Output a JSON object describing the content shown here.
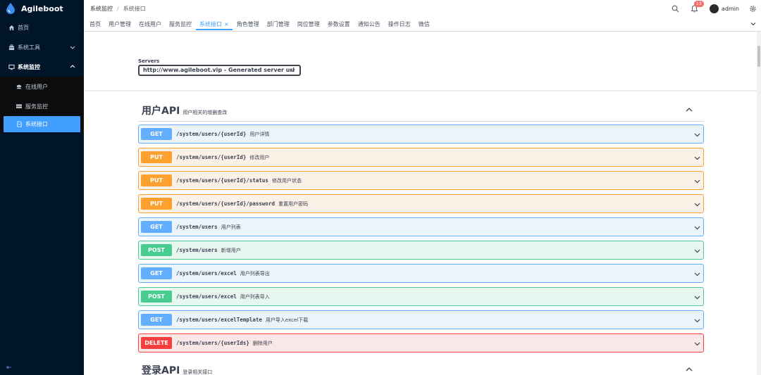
{
  "app": {
    "name": "Agileboot"
  },
  "sidebar": {
    "items": [
      {
        "label": "首页",
        "icon": "home-icon"
      },
      {
        "label": "系统工具",
        "icon": "toolbox-icon"
      },
      {
        "label": "系统监控",
        "icon": "monitor-icon"
      }
    ],
    "submenu": [
      {
        "label": "在线用户",
        "icon": "users-icon"
      },
      {
        "label": "服务监控",
        "icon": "server-icon"
      },
      {
        "label": "系统接口",
        "icon": "document-icon"
      }
    ],
    "collapse_glyph": "⇤"
  },
  "breadcrumb": {
    "parent": "系统监控",
    "separator": "/",
    "current": "系统接口"
  },
  "navbar": {
    "notification_count": "13",
    "username": "admin"
  },
  "tags": [
    "首页",
    "用户管理",
    "在线用户",
    "服务监控",
    "系统接口",
    "角色管理",
    "部门管理",
    "岗位管理",
    "参数设置",
    "通知公告",
    "操作日志",
    "微信"
  ],
  "tags_active": "系统接口",
  "servers": {
    "label": "Servers",
    "selected": "http://www.agileboot.vip - Generated server url"
  },
  "sections": [
    {
      "title": "用户API",
      "description": "用户相关的增删查改",
      "operations": [
        {
          "method": "GET",
          "path": "/system/users/{userId}",
          "summary": "用户详情"
        },
        {
          "method": "PUT",
          "path": "/system/users/{userId}",
          "summary": "修改用户"
        },
        {
          "method": "PUT",
          "path": "/system/users/{userId}/status",
          "summary": "修改用户状态"
        },
        {
          "method": "PUT",
          "path": "/system/users/{userId}/password",
          "summary": "重置用户密码"
        },
        {
          "method": "GET",
          "path": "/system/users",
          "summary": "用户列表"
        },
        {
          "method": "POST",
          "path": "/system/users",
          "summary": "新增用户"
        },
        {
          "method": "GET",
          "path": "/system/users/excel",
          "summary": "用户列表导出"
        },
        {
          "method": "POST",
          "path": "/system/users/excel",
          "summary": "用户列表导入"
        },
        {
          "method": "GET",
          "path": "/system/users/excelTemplate",
          "summary": "用户导入excel下载"
        },
        {
          "method": "DELETE",
          "path": "/system/users/{userIds}",
          "summary": "删除用户"
        }
      ]
    },
    {
      "title": "登录API",
      "description": "登录相关接口",
      "operations": []
    }
  ],
  "colors": {
    "sidebar_bg": "#001529",
    "accent": "#409eff",
    "get": "#61affe",
    "put": "#fca130",
    "post": "#49cc90",
    "delete": "#f93e3e"
  }
}
